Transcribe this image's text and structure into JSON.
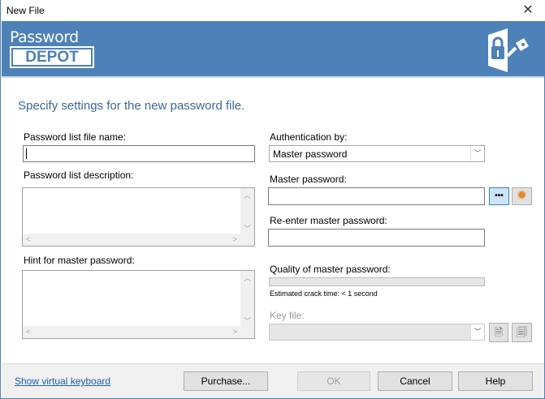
{
  "window": {
    "title": "New File",
    "close": "✕"
  },
  "logo": {
    "line1": "Password",
    "line2": "DEPOT"
  },
  "heading": "Specify settings for the new password file.",
  "left": {
    "file_name_label": "Password list file name:",
    "file_name_value": "",
    "description_label": "Password list description:",
    "hint_label": "Hint for master password:"
  },
  "right": {
    "auth_label": "Authentication by:",
    "auth_value": "Master password",
    "master_label": "Master password:",
    "master_value": "",
    "dots_button": "•••",
    "reenter_label": "Re-enter master password:",
    "quality_label": "Quality of master password:",
    "quality_percent": 0,
    "crack_time": "Estimated crack time: < 1 second",
    "keyfile_label": "Key file:"
  },
  "footer": {
    "keyboard_link": "Show virtual keyboard",
    "purchase": "Purchase...",
    "ok": "OK",
    "cancel": "Cancel",
    "help": "Help"
  },
  "colors": {
    "header": "#4d81b8",
    "accent_gear": "#e8872a"
  }
}
